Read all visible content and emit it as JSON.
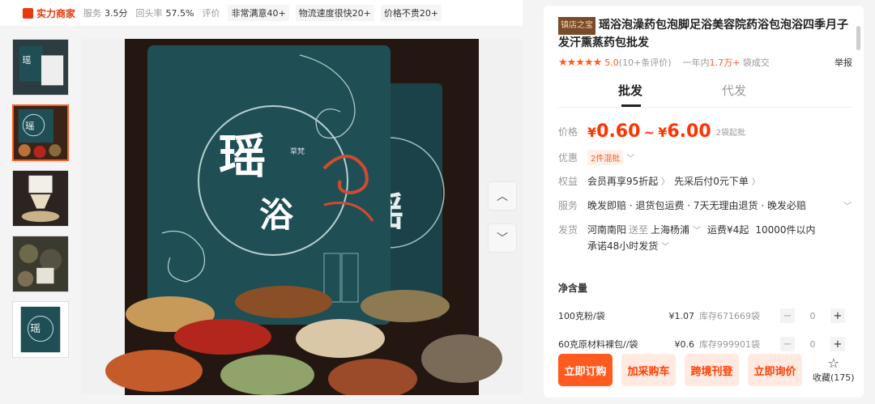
{
  "top_bar": {
    "seller_label": "实力商家",
    "stats": [
      {
        "label": "服务",
        "value": "3.5分"
      },
      {
        "label": "回头率",
        "value": "57.5%"
      },
      {
        "label": "评价",
        "value": ""
      }
    ],
    "tags": [
      "非常满意40+",
      "物流速度很快20+",
      "价格不贵20+"
    ]
  },
  "product": {
    "badge": "镇店之宝",
    "title": "瑶浴泡澡药包泡脚足浴美容院药浴包泡浴四季月子发汗熏蒸药包批发",
    "stars": "★★★★★",
    "rating": "5.0",
    "review_count": "(10+条评价)",
    "sold_prefix": "一年内",
    "sold_count": "1.7万+",
    "sold_suffix": "袋成交",
    "report": "举报"
  },
  "tabs": [
    "批发",
    "代发"
  ],
  "price": {
    "label": "价格",
    "low_currency": "¥",
    "low": "0.60",
    "sep": "~",
    "high_currency": "¥",
    "high": "6.00",
    "moq": "2袋起批"
  },
  "discount": {
    "label": "优惠",
    "tag": "2件混批"
  },
  "rights": {
    "label": "权益",
    "item1": "会员再享95折起",
    "item2": "先采后付0元下单"
  },
  "service": {
    "label": "服务",
    "text": "晚发即赔 · 退货包运费 · 7天无理由退货 · 晚发必赔"
  },
  "shipping": {
    "label": "发货",
    "from": "河南南阳",
    "to_label": "送至",
    "to": "上海杨浦",
    "fee": "运费¥4起",
    "stock": "10000件以内",
    "promise": "承诺48小时发货"
  },
  "specs": {
    "title": "净含量",
    "rows": [
      {
        "name": "100克粉/袋",
        "price": "¥1.07",
        "stock": "库存671669袋",
        "qty": "0"
      },
      {
        "name": "60克原材料裸包//袋",
        "price": "¥0.6",
        "stock": "库存999901袋",
        "qty": "0"
      }
    ]
  },
  "actions": {
    "order": "立即订购",
    "cart": "加采购车",
    "cross": "跨境刊登",
    "inquiry": "立即询价",
    "favorite": "收藏(175)"
  },
  "image_text": {
    "brand_big": "瑶浴",
    "brand_small": "草梵"
  },
  "colors": {
    "accent": "#ff5a1f",
    "price": "#ff3300",
    "package": "#1f4f55",
    "badge": "#7a4b2a"
  }
}
